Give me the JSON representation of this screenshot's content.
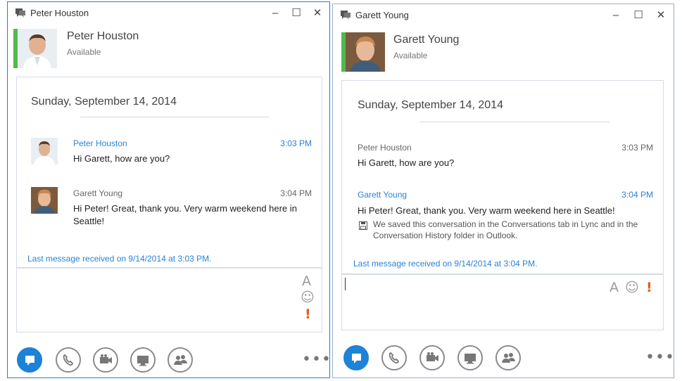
{
  "left_window": {
    "title": "Peter Houston",
    "contact": {
      "name": "Peter Houston",
      "status": "Available"
    },
    "date_header": "Sunday, September 14, 2014",
    "messages": [
      {
        "sender": "Peter Houston",
        "time": "3:03 PM",
        "text": "Hi Garett, how are you?"
      },
      {
        "sender": "Garett Young",
        "time": "3:04 PM",
        "text": "Hi Peter! Great, thank you. Very warm weekend here in Seattle!"
      }
    ],
    "last_message": "Last message received on 9/14/2014 at 3:03 PM."
  },
  "right_window": {
    "title": "Garett Young",
    "contact": {
      "name": "Garett Young",
      "status": "Available"
    },
    "date_header": "Sunday, September 14, 2014",
    "messages": [
      {
        "sender": "Peter Houston",
        "time": "3:03 PM",
        "text": "Hi Garett, how are you?"
      },
      {
        "sender": "Garett Young",
        "time": "3:04 PM",
        "text": "Hi Peter! Great, thank you. Very warm weekend here in Seattle!",
        "note": "We saved this conversation in the Conversations tab in Lync and in the Conversation History folder in Outlook."
      }
    ],
    "last_message": "Last message received on 9/14/2014 at 3:04 PM."
  },
  "window_controls": {
    "minimize": "–",
    "maximize": "☐",
    "close": "✕"
  },
  "compose_tools": {
    "font": "A",
    "emoticon": "☺",
    "priority": "!"
  },
  "overflow_menu": "•••",
  "toolbar_icons": [
    "im-icon",
    "phone-icon",
    "video-icon",
    "screen-share-icon",
    "people-icon"
  ],
  "colors": {
    "accent": "#1e82d8",
    "presence_available": "#51b94f",
    "link": "#2a82d8",
    "priority": "#e25c1c"
  }
}
